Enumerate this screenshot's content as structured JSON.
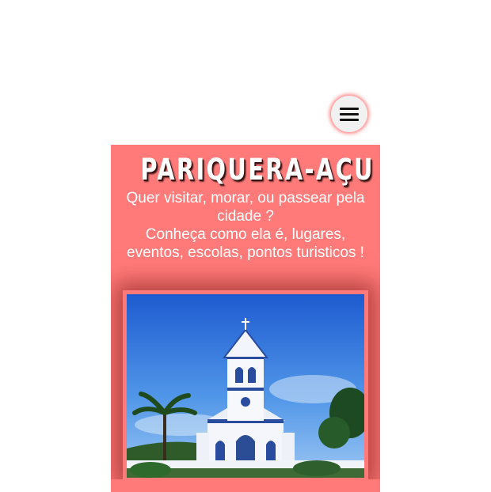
{
  "header": {
    "menu_icon": "hamburger-menu-icon"
  },
  "hero": {
    "title": "PARIQUERA-AÇU",
    "subtitle_line1": "Quer visitar, morar, ou passear pela cidade ?",
    "subtitle_line2": "Conheça como ela é, lugares, eventos, escolas, pontos turisticos !"
  },
  "image": {
    "subject": "church-photo"
  },
  "colors": {
    "card_background": "#ff7a78",
    "menu_glow": "#ff6e6e",
    "title_text": "#ffffff"
  }
}
